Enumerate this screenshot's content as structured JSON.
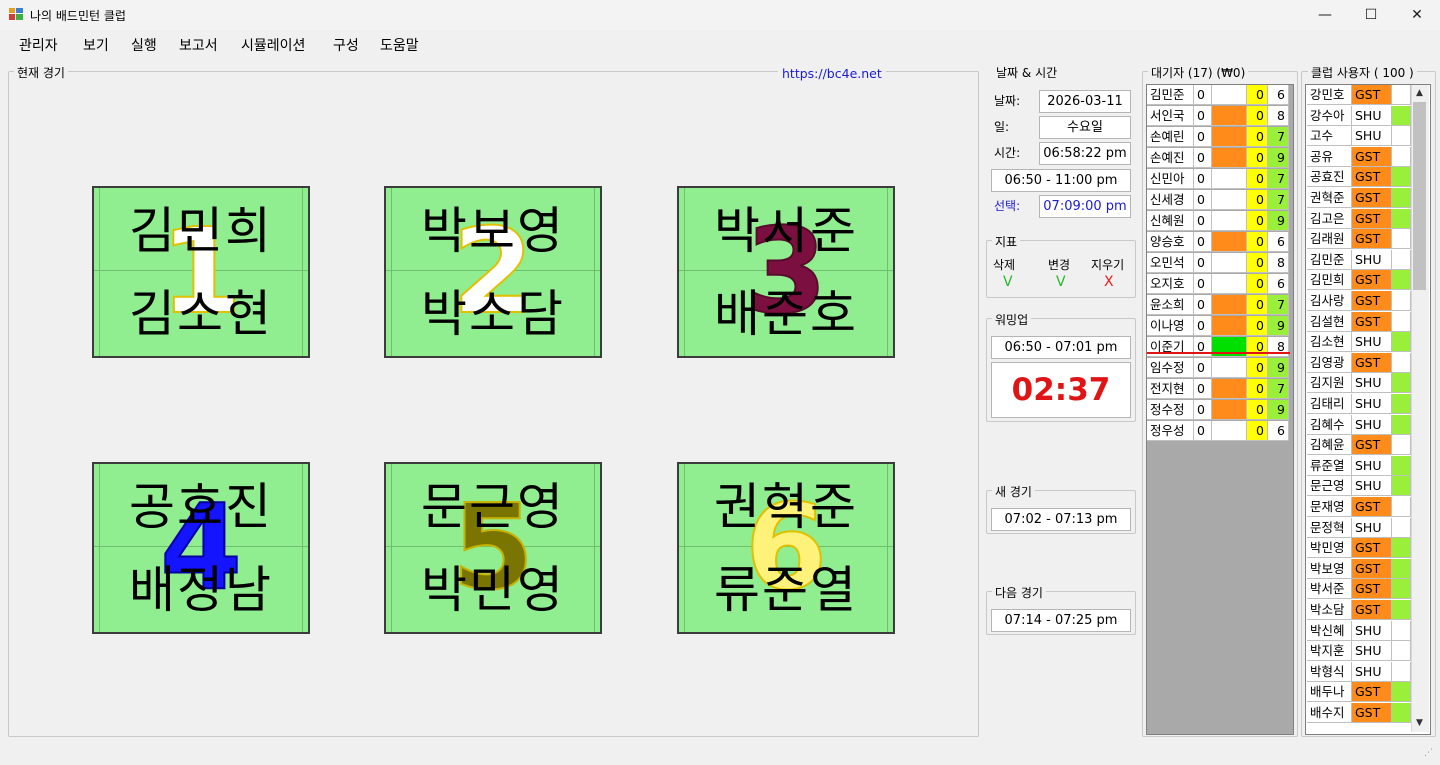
{
  "window": {
    "title": "나의 배드민턴 클럽",
    "minimize": "—",
    "maximize": "☐",
    "close": "✕"
  },
  "menu": [
    "관리자",
    "보기",
    "실행",
    "보고서",
    "시뮬레이션",
    "구성",
    "도움말"
  ],
  "current_games": {
    "label": "현재 경기",
    "link": "https://bc4e.net",
    "courts": [
      {
        "number": "1",
        "top": "김민희",
        "bottom": "김소현",
        "color": "#ffffff"
      },
      {
        "number": "2",
        "top": "박보영",
        "bottom": "박소담",
        "color": "#ffffff"
      },
      {
        "number": "3",
        "top": "박서준",
        "bottom": "배준호",
        "color": "#7b1040"
      },
      {
        "number": "4",
        "top": "공효진",
        "bottom": "배정남",
        "color": "#1414ff"
      },
      {
        "number": "5",
        "top": "문근영",
        "bottom": "박민영",
        "color": "#7a7400"
      },
      {
        "number": "6",
        "top": "권혁준",
        "bottom": "류준열",
        "color": "#fff27a"
      }
    ]
  },
  "datetime": {
    "label": "날짜 & 시간",
    "date_label": "날짜:",
    "date": "2026-03-11",
    "day_label": "일:",
    "day": "수요일",
    "time_label": "시간:",
    "time": "06:58:22 pm",
    "session": "06:50 - 11:00 pm",
    "select_label": "선택:",
    "select_time": "07:09:00 pm"
  },
  "indicators": {
    "label": "지표",
    "items": [
      {
        "name": "삭제",
        "mark": "V",
        "color": "#2bb52b"
      },
      {
        "name": "변경",
        "mark": "V",
        "color": "#2bb52b"
      },
      {
        "name": "지우기",
        "mark": "X",
        "color": "#e02020"
      }
    ]
  },
  "warmup": {
    "label": "워밍업",
    "range": "06:50 - 07:01 pm",
    "countdown": "02:37"
  },
  "new_game": {
    "label": "새 경기",
    "range": "07:02 - 07:13 pm"
  },
  "next_game": {
    "label": "다음 경기",
    "range": "07:14 - 07:25 pm"
  },
  "queue": {
    "label": "대기자 (17) (₩0)",
    "rows": [
      {
        "name": "김민준",
        "a": "0",
        "flag": "white",
        "b": "0",
        "c": "6",
        "cc": "white"
      },
      {
        "name": "서인국",
        "a": "0",
        "flag": "orange",
        "b": "0",
        "c": "8",
        "cc": "white"
      },
      {
        "name": "손예린",
        "a": "0",
        "flag": "orange",
        "b": "0",
        "c": "7",
        "cc": "lime"
      },
      {
        "name": "손예진",
        "a": "0",
        "flag": "orange",
        "b": "0",
        "c": "9",
        "cc": "lime"
      },
      {
        "name": "신민아",
        "a": "0",
        "flag": "white",
        "b": "0",
        "c": "7",
        "cc": "lime"
      },
      {
        "name": "신세경",
        "a": "0",
        "flag": "white",
        "b": "0",
        "c": "7",
        "cc": "lime"
      },
      {
        "name": "신혜원",
        "a": "0",
        "flag": "white",
        "b": "0",
        "c": "9",
        "cc": "lime"
      },
      {
        "name": "양승호",
        "a": "0",
        "flag": "orange",
        "b": "0",
        "c": "6",
        "cc": "white"
      },
      {
        "name": "오민석",
        "a": "0",
        "flag": "white",
        "b": "0",
        "c": "8",
        "cc": "white"
      },
      {
        "name": "오지호",
        "a": "0",
        "flag": "white",
        "b": "0",
        "c": "6",
        "cc": "white"
      },
      {
        "name": "윤소희",
        "a": "0",
        "flag": "orange",
        "b": "0",
        "c": "7",
        "cc": "lime"
      },
      {
        "name": "이나영",
        "a": "0",
        "flag": "orange",
        "b": "0",
        "c": "9",
        "cc": "lime"
      },
      {
        "name": "이준기",
        "a": "0",
        "flag": "green",
        "b": "0",
        "c": "8",
        "cc": "white"
      },
      {
        "name": "임수정",
        "a": "0",
        "flag": "white",
        "b": "0",
        "c": "9",
        "cc": "lime"
      },
      {
        "name": "전지현",
        "a": "0",
        "flag": "orange",
        "b": "0",
        "c": "7",
        "cc": "lime"
      },
      {
        "name": "정수정",
        "a": "0",
        "flag": "orange",
        "b": "0",
        "c": "9",
        "cc": "lime"
      },
      {
        "name": "정우성",
        "a": "0",
        "flag": "white",
        "b": "0",
        "c": "6",
        "cc": "white"
      }
    ]
  },
  "members": {
    "label": "클럽 사용자 ( 100 )",
    "rows": [
      {
        "name": "강민호",
        "type": "GST",
        "flag": "white"
      },
      {
        "name": "강수아",
        "type": "SHU",
        "flag": "lime"
      },
      {
        "name": "고수",
        "type": "SHU",
        "flag": "white"
      },
      {
        "name": "공유",
        "type": "GST",
        "flag": "white"
      },
      {
        "name": "공효진",
        "type": "GST",
        "flag": "lime"
      },
      {
        "name": "권혁준",
        "type": "GST",
        "flag": "lime"
      },
      {
        "name": "김고은",
        "type": "GST",
        "flag": "lime"
      },
      {
        "name": "김래원",
        "type": "GST",
        "flag": "white"
      },
      {
        "name": "김민준",
        "type": "SHU",
        "flag": "white"
      },
      {
        "name": "김민희",
        "type": "GST",
        "flag": "lime"
      },
      {
        "name": "김사랑",
        "type": "GST",
        "flag": "white"
      },
      {
        "name": "김설현",
        "type": "GST",
        "flag": "white"
      },
      {
        "name": "김소현",
        "type": "SHU",
        "flag": "lime"
      },
      {
        "name": "김영광",
        "type": "GST",
        "flag": "white"
      },
      {
        "name": "김지원",
        "type": "SHU",
        "flag": "lime"
      },
      {
        "name": "김태리",
        "type": "SHU",
        "flag": "lime"
      },
      {
        "name": "김혜수",
        "type": "SHU",
        "flag": "lime"
      },
      {
        "name": "김혜윤",
        "type": "GST",
        "flag": "white"
      },
      {
        "name": "류준열",
        "type": "SHU",
        "flag": "lime"
      },
      {
        "name": "문근영",
        "type": "SHU",
        "flag": "lime"
      },
      {
        "name": "문재영",
        "type": "GST",
        "flag": "white"
      },
      {
        "name": "문정혁",
        "type": "SHU",
        "flag": "white"
      },
      {
        "name": "박민영",
        "type": "GST",
        "flag": "lime"
      },
      {
        "name": "박보영",
        "type": "GST",
        "flag": "lime"
      },
      {
        "name": "박서준",
        "type": "GST",
        "flag": "lime"
      },
      {
        "name": "박소담",
        "type": "GST",
        "flag": "lime"
      },
      {
        "name": "박신혜",
        "type": "SHU",
        "flag": "white"
      },
      {
        "name": "박지훈",
        "type": "SHU",
        "flag": "white"
      },
      {
        "name": "박형식",
        "type": "SHU",
        "flag": "white"
      },
      {
        "name": "배두나",
        "type": "GST",
        "flag": "lime"
      },
      {
        "name": "배수지",
        "type": "GST",
        "flag": "lime"
      }
    ]
  },
  "colors": {
    "orange": "#ff8c1a",
    "yellow": "#ffff00",
    "lime": "#9aef3a",
    "green": "#00e000",
    "court": "#90ee90"
  }
}
